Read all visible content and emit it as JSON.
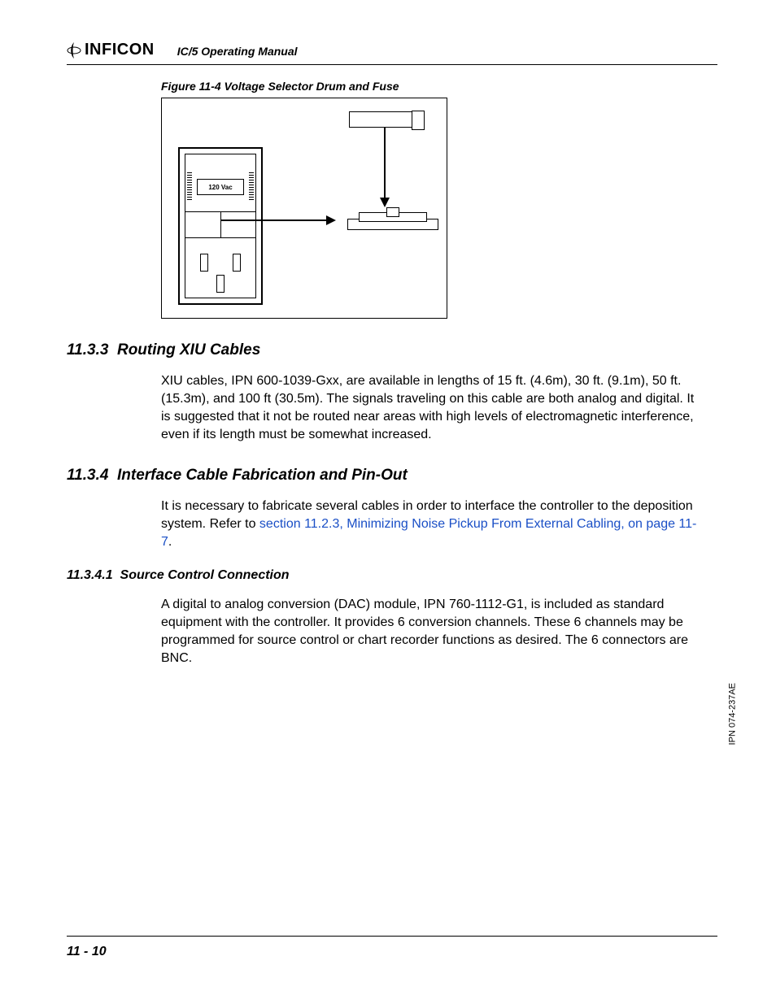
{
  "header": {
    "brand": "INFICON",
    "manual_title": "IC/5 Operating Manual"
  },
  "figure": {
    "caption": "Figure 11-4  Voltage Selector Drum and Fuse",
    "drum_label": "120 Vac"
  },
  "sections": {
    "s1_num": "11.3.3",
    "s1_title": "Routing XIU Cables",
    "s1_body": "XIU cables, IPN 600-1039-Gxx, are available in lengths of 15 ft. (4.6m), 30 ft. (9.1m), 50 ft. (15.3m), and 100 ft (30.5m). The signals traveling on this cable are both analog and digital. It is suggested that it not be routed near areas with high levels of electromagnetic interference, even if its length must be somewhat increased.",
    "s2_num": "11.3.4",
    "s2_title": "Interface Cable Fabrication and Pin-Out",
    "s2_body_pre": "It is necessary to fabricate several cables in order to interface the controller to the deposition system. Refer to ",
    "s2_link": "section 11.2.3, Minimizing Noise Pickup From External Cabling, on page 11-7",
    "s2_body_post": ".",
    "s3_num": "11.3.4.1",
    "s3_title": "Source Control Connection",
    "s3_body": "A digital to analog conversion (DAC) module, IPN 760-1112-G1, is included as standard equipment with the controller. It provides 6 conversion channels. These 6 channels may be programmed for source control or chart recorder functions as desired. The 6 connectors are BNC."
  },
  "footer": {
    "page_number": "11 - 10",
    "ipn": "IPN 074-237AE"
  }
}
